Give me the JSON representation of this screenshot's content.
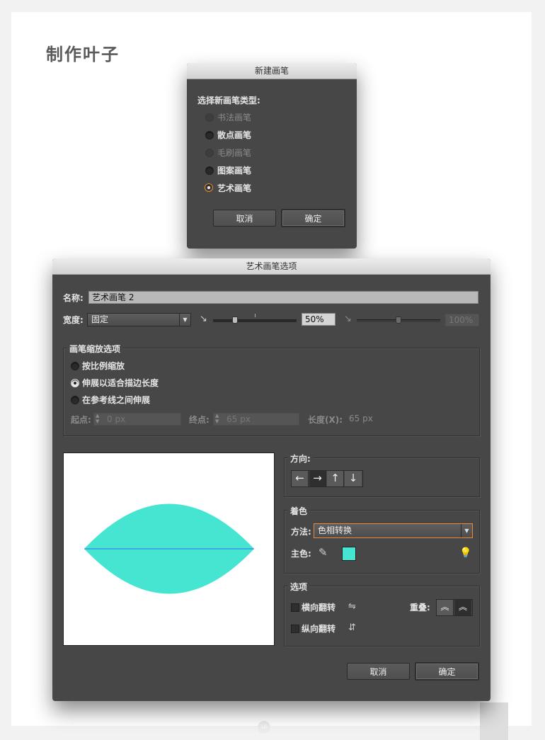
{
  "page": {
    "heading": "制作叶子"
  },
  "new_brush_dialog": {
    "title": "新建画笔",
    "prompt": "选择新画笔类型:",
    "options": [
      {
        "label": "书法画笔",
        "state": "disabled"
      },
      {
        "label": "散点画笔",
        "state": "normal"
      },
      {
        "label": "毛刷画笔",
        "state": "disabled"
      },
      {
        "label": "图案画笔",
        "state": "normal"
      },
      {
        "label": "艺术画笔",
        "state": "selected"
      }
    ],
    "cancel_label": "取消",
    "ok_label": "确定"
  },
  "art_brush_dialog": {
    "title": "艺术画笔选项",
    "name_label": "名称:",
    "name_value": "艺术画笔 2",
    "width_label": "宽度:",
    "width_value": "固定",
    "width_percent": "50%",
    "width_percent_max": "100%",
    "scale_group": {
      "title": "画笔缩放选项",
      "options": [
        "按比例缩放",
        "伸展以适合描边长度",
        "在参考线之间伸展"
      ],
      "selected_index": 1,
      "start_label": "起点:",
      "start_value": "0 px",
      "end_label": "终点:",
      "end_value": "65 px",
      "length_label": "长度(X):",
      "length_value": "65 px"
    },
    "direction": {
      "title": "方向:",
      "buttons": [
        "←",
        "→",
        "↑",
        "↓"
      ],
      "active_index": 1
    },
    "colorization": {
      "title": "着色",
      "method_label": "方法:",
      "method_value": "色相转换",
      "key_color_label": "主色:",
      "key_color": "#46e5d2"
    },
    "options_group": {
      "title": "选项",
      "flip_along_label": "横向翻转",
      "flip_across_label": "纵向翻转",
      "overlap_label": "重叠:"
    },
    "cancel_label": "取消",
    "ok_label": "确定"
  },
  "preview": {
    "leaf_color": "#46e5d2",
    "midline_color": "#3b6cf0"
  },
  "watermark": {
    "text": "UI"
  }
}
